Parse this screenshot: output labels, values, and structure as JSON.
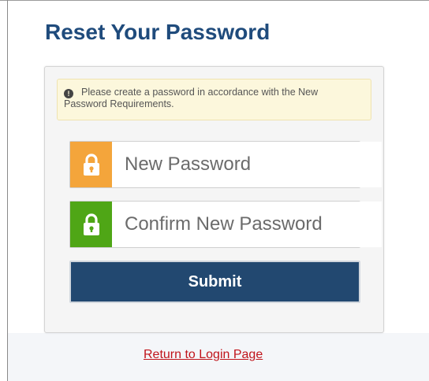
{
  "page": {
    "title": "Reset Your Password"
  },
  "alert": {
    "icon": "exclamation-circle-icon",
    "message": "Please create a password in accordance with the New Password Requirements."
  },
  "new_password": {
    "placeholder": "New Password",
    "icon": "lock-icon",
    "icon_color": "#f4a53b"
  },
  "confirm_password": {
    "placeholder": "Confirm New Password",
    "icon": "lock-icon",
    "icon_color": "#4fa616"
  },
  "submit": {
    "label": "Submit",
    "color": "#224870"
  },
  "return_link": {
    "label": "Return to Login Page",
    "color": "#c0141b"
  },
  "colors": {
    "title": "#1f4b7c",
    "alert_background": "#fcf7dc"
  }
}
